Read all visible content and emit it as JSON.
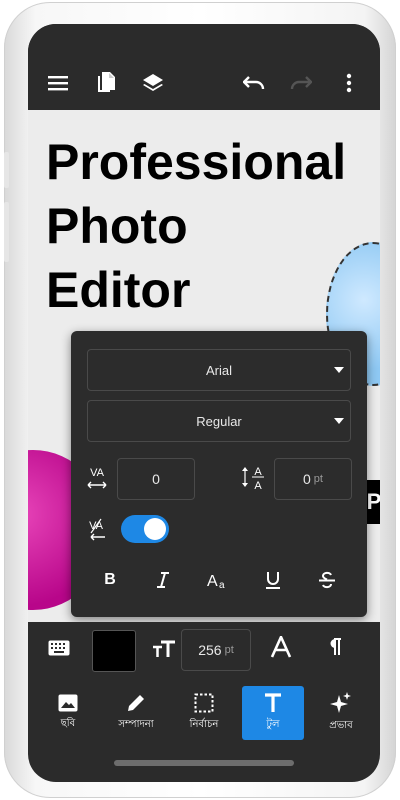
{
  "canvas": {
    "headline_lines": [
      "Professional",
      "Photo",
      "Editor"
    ],
    "partial_letter": "P"
  },
  "text_panel": {
    "font_family": "Arial",
    "font_style": "Regular",
    "letter_spacing": "0",
    "line_spacing": "0",
    "line_spacing_unit": "pt",
    "tracking_toggle_on": true,
    "format_buttons": [
      "bold",
      "italic",
      "font-case",
      "underline",
      "strikethrough"
    ]
  },
  "bottom_tools": {
    "font_size": "256",
    "font_size_unit": "pt",
    "color": "#000000"
  },
  "nav": {
    "items": [
      {
        "label": "ছবি",
        "icon": "image-icon"
      },
      {
        "label": "সম্পাদনা",
        "icon": "pencil-icon"
      },
      {
        "label": "নির্বাচন",
        "icon": "selection-icon"
      },
      {
        "label": "টুল",
        "icon": "text-tool-icon"
      },
      {
        "label": "প্রভাব",
        "icon": "sparkle-icon"
      }
    ],
    "active_index": 3
  },
  "colors": {
    "accent": "#1e88e5",
    "toolbar": "#2b2b2b",
    "canvas": "#ececec"
  }
}
